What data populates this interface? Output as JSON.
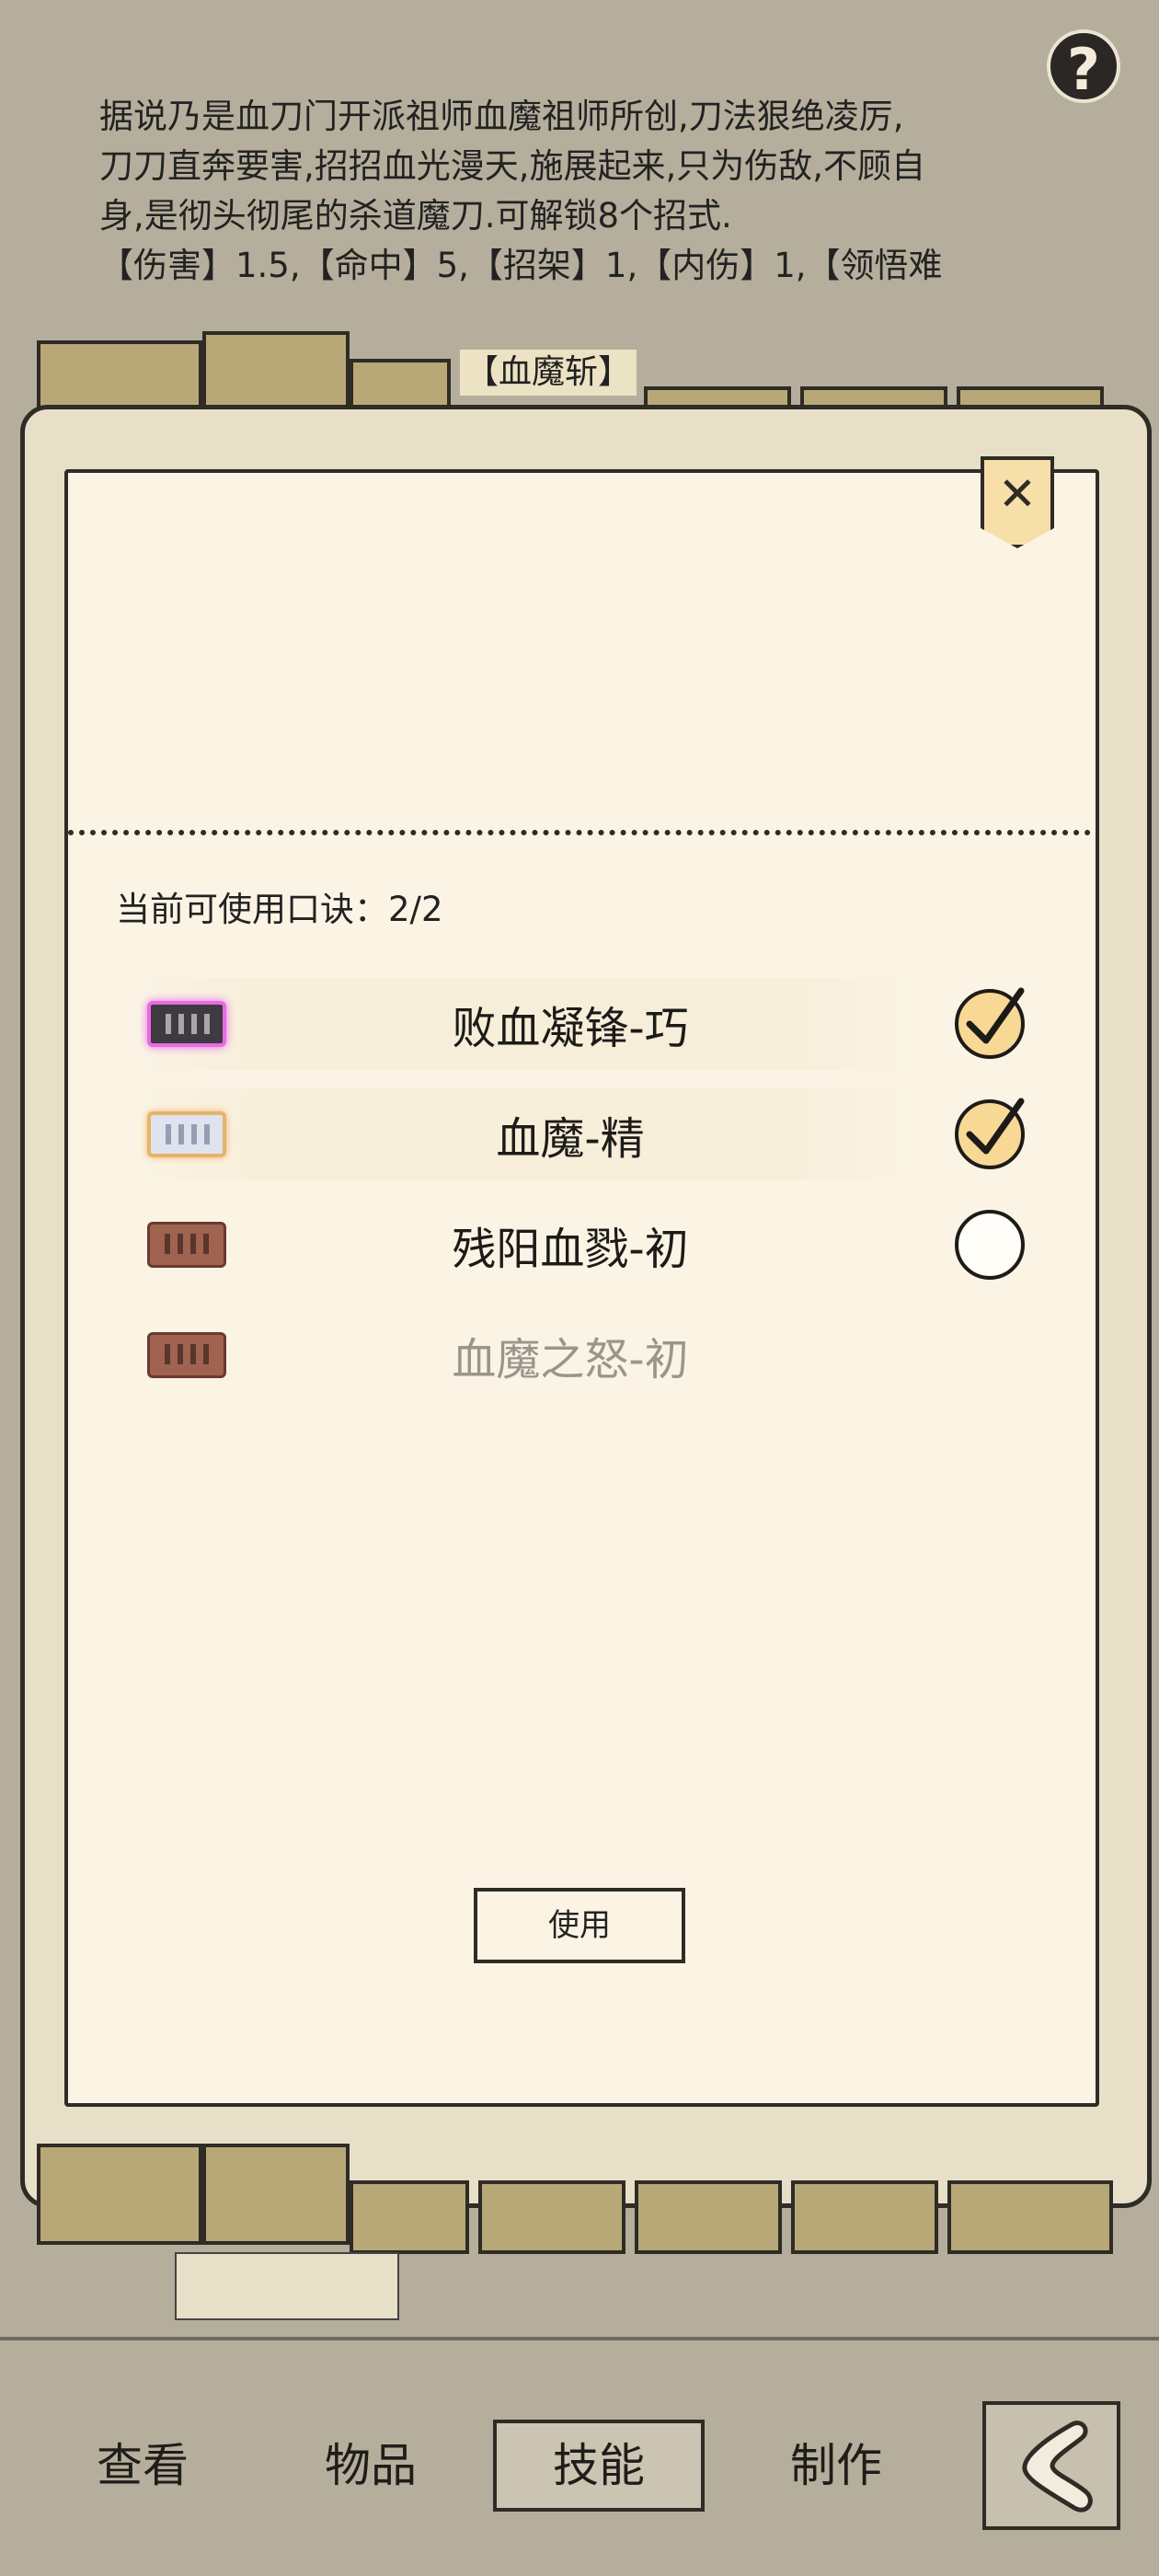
{
  "help": {
    "icon": "question-icon",
    "symbol": "?"
  },
  "description": {
    "lines": [
      "据说乃是血刀门开派祖师血魔祖师所创,刀法狠绝凌厉,",
      "刀刀直奔要害,招招血光漫天,施展起来,只为伤敌,不顾自",
      "身,是彻头彻尾的杀道魔刀.可解锁8个招式.",
      "【伤害】1.5,【命中】5,【招架】1,【内伤】1,【领悟难"
    ],
    "skill_tag": "【血魔斩】"
  },
  "dialog": {
    "close_symbol": "✕",
    "quota_label": "当前可使用口诀：2/2",
    "mantras": [
      {
        "name": "败血凝锋-巧",
        "tier_color": "#e86ae4",
        "icon": "purple-scroll-icon",
        "selected": true,
        "enabled": true
      },
      {
        "name": "血魔-精",
        "tier_color": "#e7b36a",
        "icon": "silver-scroll-icon",
        "selected": true,
        "enabled": true
      },
      {
        "name": "残阳血戮-初",
        "tier_color": "#a0634f",
        "icon": "brown-scroll-icon",
        "selected": false,
        "enabled": true
      },
      {
        "name": "血魔之怒-初",
        "tier_color": "#a0634f",
        "icon": "brown-scroll-icon",
        "selected": false,
        "enabled": false
      }
    ],
    "use_label": "使用"
  },
  "nav": {
    "items": [
      {
        "label": "查看",
        "active": false
      },
      {
        "label": "物品",
        "active": false
      },
      {
        "label": "技能",
        "active": true
      },
      {
        "label": "制作",
        "active": false
      }
    ],
    "back_icon": "back-arrow-icon"
  }
}
